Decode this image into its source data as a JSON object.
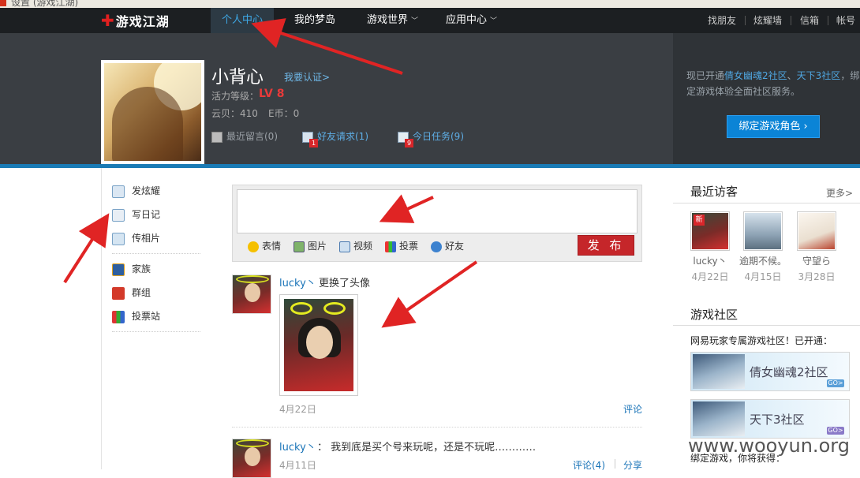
{
  "browser": {
    "title": "设置 (游戏江湖)"
  },
  "logo": {
    "text": "游戏江湖"
  },
  "nav": {
    "items": [
      {
        "label": "个人中心",
        "active": true
      },
      {
        "label": "我的梦岛"
      },
      {
        "label": "游戏世界",
        "chevron": "﹀"
      },
      {
        "label": "应用中心",
        "chevron": "﹀"
      }
    ],
    "right": [
      "找朋友",
      "炫耀墙",
      "信箱",
      "帐号"
    ]
  },
  "profile": {
    "username": "小背心",
    "verify_link": "我要认证>",
    "level_label": "活力等级：",
    "level_value": "LV 8",
    "cloud": "云贝：410",
    "ecoin": "E币：0",
    "links": [
      {
        "label": "最近留言(0)",
        "badge": ""
      },
      {
        "label": "好友请求(1)",
        "badge": "1"
      },
      {
        "label": "今日任务(9)",
        "badge": "9"
      }
    ]
  },
  "promo": {
    "text_before": "现已开通",
    "link1": "倩女幽魂2社区",
    "sep": "、",
    "link2": "天下3社区",
    "text_after": "，绑定游戏体验全面社区服务。",
    "button": "绑定游戏角色 ›"
  },
  "sidebar": {
    "group1": [
      "发炫耀",
      "写日记",
      "传相片"
    ],
    "group2": [
      "家族",
      "群组",
      "投票站"
    ]
  },
  "composer": {
    "tools": [
      "表情",
      "图片",
      "视频",
      "投票",
      "好友"
    ],
    "publish": "发 布"
  },
  "feed": [
    {
      "user": "lucky丶",
      "text": "更换了头像",
      "date": "4月22日",
      "actions": [
        "评论"
      ]
    },
    {
      "user": "lucky丶",
      "text": "： 我到底是买个号来玩呢，还是不玩呢…………",
      "date": "4月11日",
      "actions": [
        "评论(4)",
        "分享"
      ]
    }
  ],
  "recent_visitors": {
    "title": "最近访客",
    "more": "更多>",
    "new_tag": "新",
    "items": [
      {
        "name": "lucky丶",
        "date": "4月22日"
      },
      {
        "name": "逾期不候。",
        "date": "4月15日"
      },
      {
        "name": "守望ら",
        "date": "3月28日"
      }
    ]
  },
  "community": {
    "title": "游戏社区",
    "subtitle": "网易玩家专属游戏社区！已开通：",
    "banners": [
      {
        "label": "倩女幽魂2社区",
        "go": "GO>",
        "go_color": "#5a9fd8"
      },
      {
        "label": "天下3社区",
        "go": "GO>",
        "go_color": "#8a7ac8"
      }
    ]
  },
  "bind_note": "绑定游戏，你将获得：",
  "watermark": "www.wooyun.org",
  "colors": {
    "nav_bg": "#1c1f22",
    "accent_blue": "#0b84d6",
    "level_red": "#e83a3a",
    "publish_red": "#c5262a",
    "link_blue": "#1a74b8",
    "arrow_red": "#e02424"
  }
}
